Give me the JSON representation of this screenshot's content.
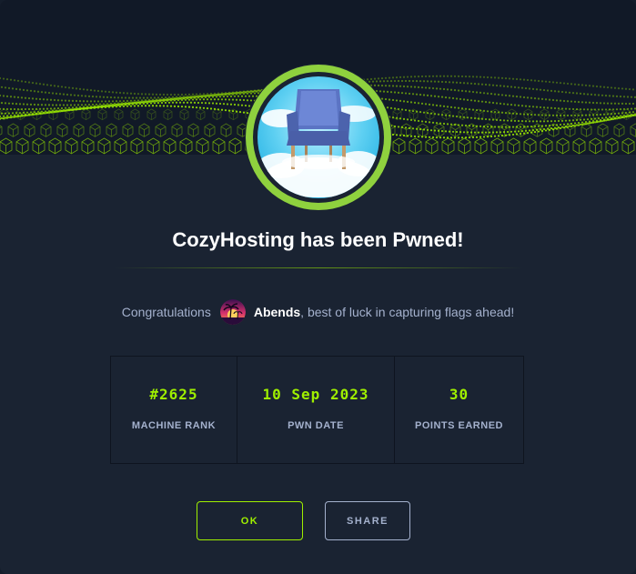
{
  "dialog": {
    "title": "CozyHosting has been Pwned!",
    "congrats_prefix": "Congratulations",
    "username": "Abends",
    "congrats_suffix": ", best of luck in capturing flags ahead!",
    "machine_icon": "chair-in-clouds-icon",
    "user_avatar_icon": "palm-sunset-avatar"
  },
  "stats": [
    {
      "value": "#2625",
      "label": "MACHINE RANK"
    },
    {
      "value": "10 Sep 2023",
      "label": "PWN DATE"
    },
    {
      "value": "30",
      "label": "POINTS EARNED"
    }
  ],
  "buttons": {
    "ok_label": "OK",
    "share_label": "SHARE"
  },
  "colors": {
    "accent": "#9fef00",
    "background": "#1a2332",
    "muted_text": "#a4b1cd",
    "ring": "#8fd13e"
  }
}
